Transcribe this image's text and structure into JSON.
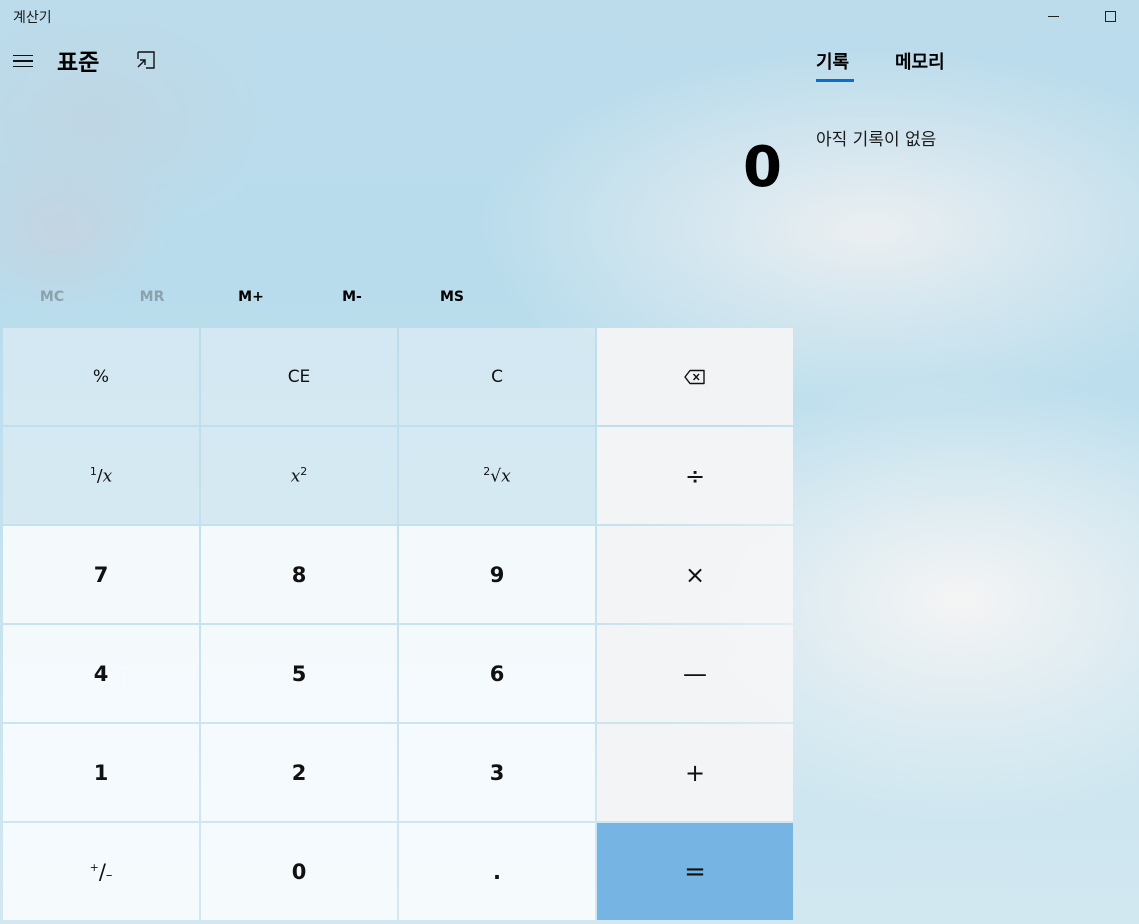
{
  "window": {
    "title": "계산기"
  },
  "header": {
    "mode_title": "표준"
  },
  "display": {
    "value": "0"
  },
  "memory": {
    "buttons": [
      {
        "label": "MC",
        "enabled": false
      },
      {
        "label": "MR",
        "enabled": false
      },
      {
        "label": "M+",
        "enabled": true
      },
      {
        "label": "M-",
        "enabled": true
      },
      {
        "label": "MS",
        "enabled": true
      }
    ]
  },
  "keypad": {
    "percent": "%",
    "ce": "CE",
    "clear": "C",
    "backspace_icon": "backspace-icon",
    "divide": "÷",
    "multiply": "×",
    "subtract": "—",
    "add": "+",
    "equals": "=",
    "decimal": ".",
    "digits": [
      "0",
      "1",
      "2",
      "3",
      "4",
      "5",
      "6",
      "7",
      "8",
      "9"
    ]
  },
  "history_panel": {
    "tabs": [
      "기록",
      "메모리"
    ],
    "active_tab": "기록",
    "empty_text": "아직 기록이 없음"
  },
  "colors": {
    "accent": "#0a6ecf",
    "equals_key": "#76b4e4"
  }
}
